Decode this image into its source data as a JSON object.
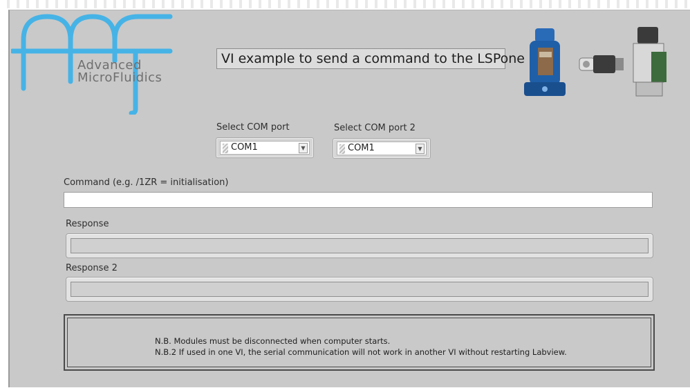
{
  "logo": {
    "line1": "Advanced",
    "line2": "MicroFluidics",
    "color": "#46b3e6"
  },
  "title": "VI example to send a command to the LSPone",
  "com_port_1": {
    "label": "Select COM port",
    "value": "COM1"
  },
  "com_port_2": {
    "label": "Select COM port 2",
    "value": "COM1"
  },
  "command": {
    "label": "Command (e.g. /1ZR = initialisation)",
    "value": ""
  },
  "response": {
    "label": "Response",
    "value": ""
  },
  "response_2": {
    "label": "Response 2",
    "value": ""
  },
  "notes": {
    "line1": "N.B. Modules must be disconnected when computer starts.",
    "line2": "N.B.2 If used in one VI, the serial communication will not work in another VI without restarting Labview."
  },
  "colors": {
    "panel": "#c9c9c9",
    "device_blue": "#1f5fa8"
  }
}
